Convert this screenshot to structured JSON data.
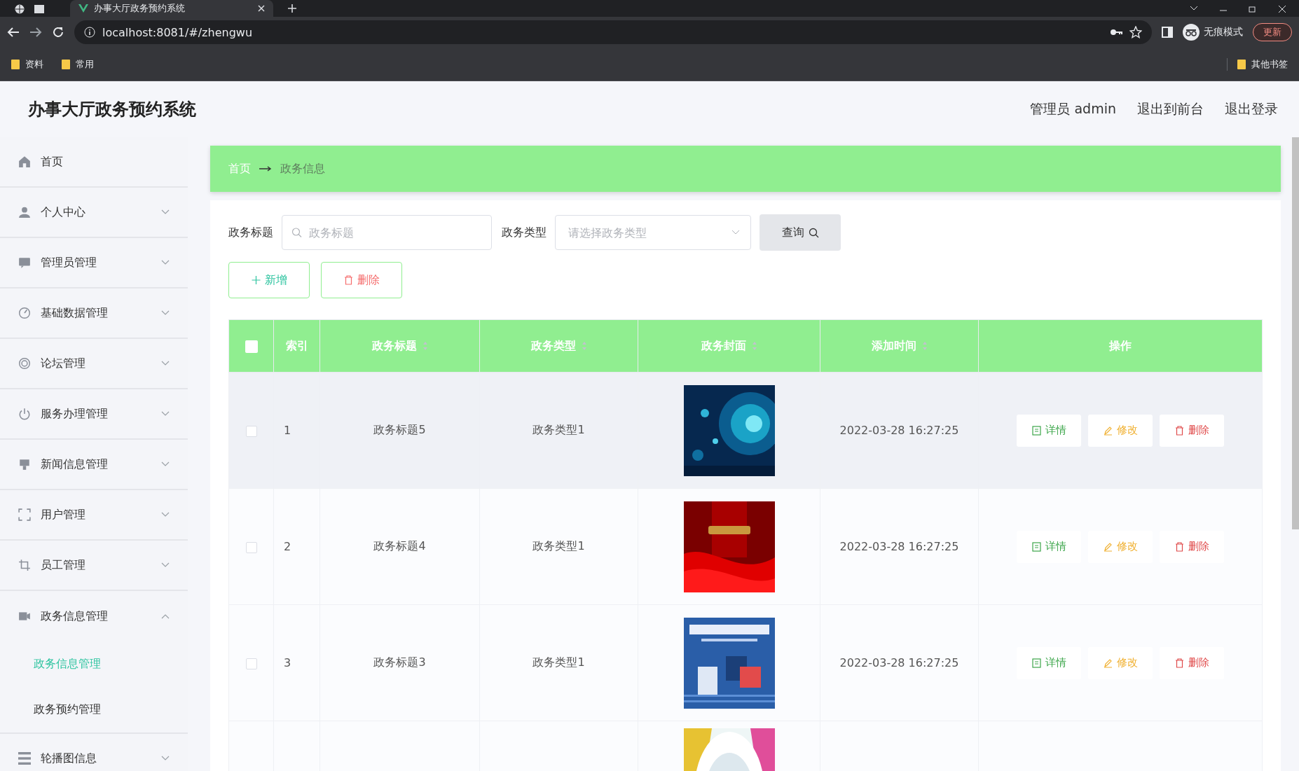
{
  "browser": {
    "tab_title": "办事大厅政务预约系统",
    "url": "localhost:8081/#/zhengwu",
    "profile_label": "无痕模式",
    "update_label": "更新",
    "bookmarks": [
      "资料",
      "常用"
    ],
    "other_bookmarks": "其他书签"
  },
  "header": {
    "title": "办事大厅政务预约系统",
    "links": [
      "管理员 admin",
      "退出到前台",
      "退出登录"
    ]
  },
  "sidebar": {
    "items": [
      {
        "label": "首页"
      },
      {
        "label": "个人中心",
        "expanded": false
      },
      {
        "label": "管理员管理",
        "expanded": false
      },
      {
        "label": "基础数据管理",
        "expanded": false
      },
      {
        "label": "论坛管理",
        "expanded": false
      },
      {
        "label": "服务办理管理",
        "expanded": false
      },
      {
        "label": "新闻信息管理",
        "expanded": false
      },
      {
        "label": "用户管理",
        "expanded": false
      },
      {
        "label": "员工管理",
        "expanded": false
      },
      {
        "label": "政务信息管理",
        "expanded": true,
        "children": [
          {
            "label": "政务信息管理",
            "selected": true
          },
          {
            "label": "政务预约管理",
            "selected": false
          }
        ]
      },
      {
        "label": "轮播图信息",
        "expanded": false
      }
    ]
  },
  "breadcrumb": [
    {
      "label": "首页",
      "current": false
    },
    {
      "label": "政务信息",
      "current": true
    }
  ],
  "filters": [
    {
      "label": "政务标题",
      "kind": "search",
      "placeholder": "政务标题"
    },
    {
      "label": "政务类型",
      "kind": "select",
      "placeholder": "请选择政务类型"
    }
  ],
  "search_button": "查询",
  "actions": [
    {
      "label": "新增",
      "kind": "add"
    },
    {
      "label": "删除",
      "kind": "delete"
    }
  ],
  "table": {
    "select_all_checked": false,
    "columns": [
      {
        "label": "索引",
        "sortable": false
      },
      {
        "label": "政务标题",
        "sortable": true
      },
      {
        "label": "政务类型",
        "sortable": true
      },
      {
        "label": "政务封面",
        "sortable": true
      },
      {
        "label": "添加时间",
        "sortable": true
      },
      {
        "label": "操作",
        "sortable": false
      }
    ],
    "rows": [
      {
        "checked": false,
        "hovered": true,
        "index": "1",
        "title": "政务标题5",
        "type": "政务类型1",
        "cover": {
          "kind": "picture"
        },
        "time": "2022-03-28 16:27:25",
        "actions": [
          {
            "label": "详情",
            "kind": "detail"
          },
          {
            "label": "修改",
            "kind": "edit"
          },
          {
            "label": "删除",
            "kind": "delete"
          }
        ]
      },
      {
        "checked": false,
        "hovered": false,
        "index": "2",
        "title": "政务标题4",
        "type": "政务类型1",
        "cover": {
          "kind": "picture"
        },
        "time": "2022-03-28 16:27:25",
        "actions": [
          {
            "label": "详情",
            "kind": "detail"
          },
          {
            "label": "修改",
            "kind": "edit"
          },
          {
            "label": "删除",
            "kind": "delete"
          }
        ]
      },
      {
        "checked": false,
        "hovered": false,
        "index": "3",
        "title": "政务标题3",
        "type": "政务类型1",
        "cover": {
          "kind": "picture"
        },
        "time": "2022-03-28 16:27:25",
        "actions": [
          {
            "label": "详情",
            "kind": "detail"
          },
          {
            "label": "修改",
            "kind": "edit"
          },
          {
            "label": "删除",
            "kind": "delete"
          }
        ]
      },
      {
        "cover": {
          "kind": "picture"
        }
      }
    ]
  }
}
